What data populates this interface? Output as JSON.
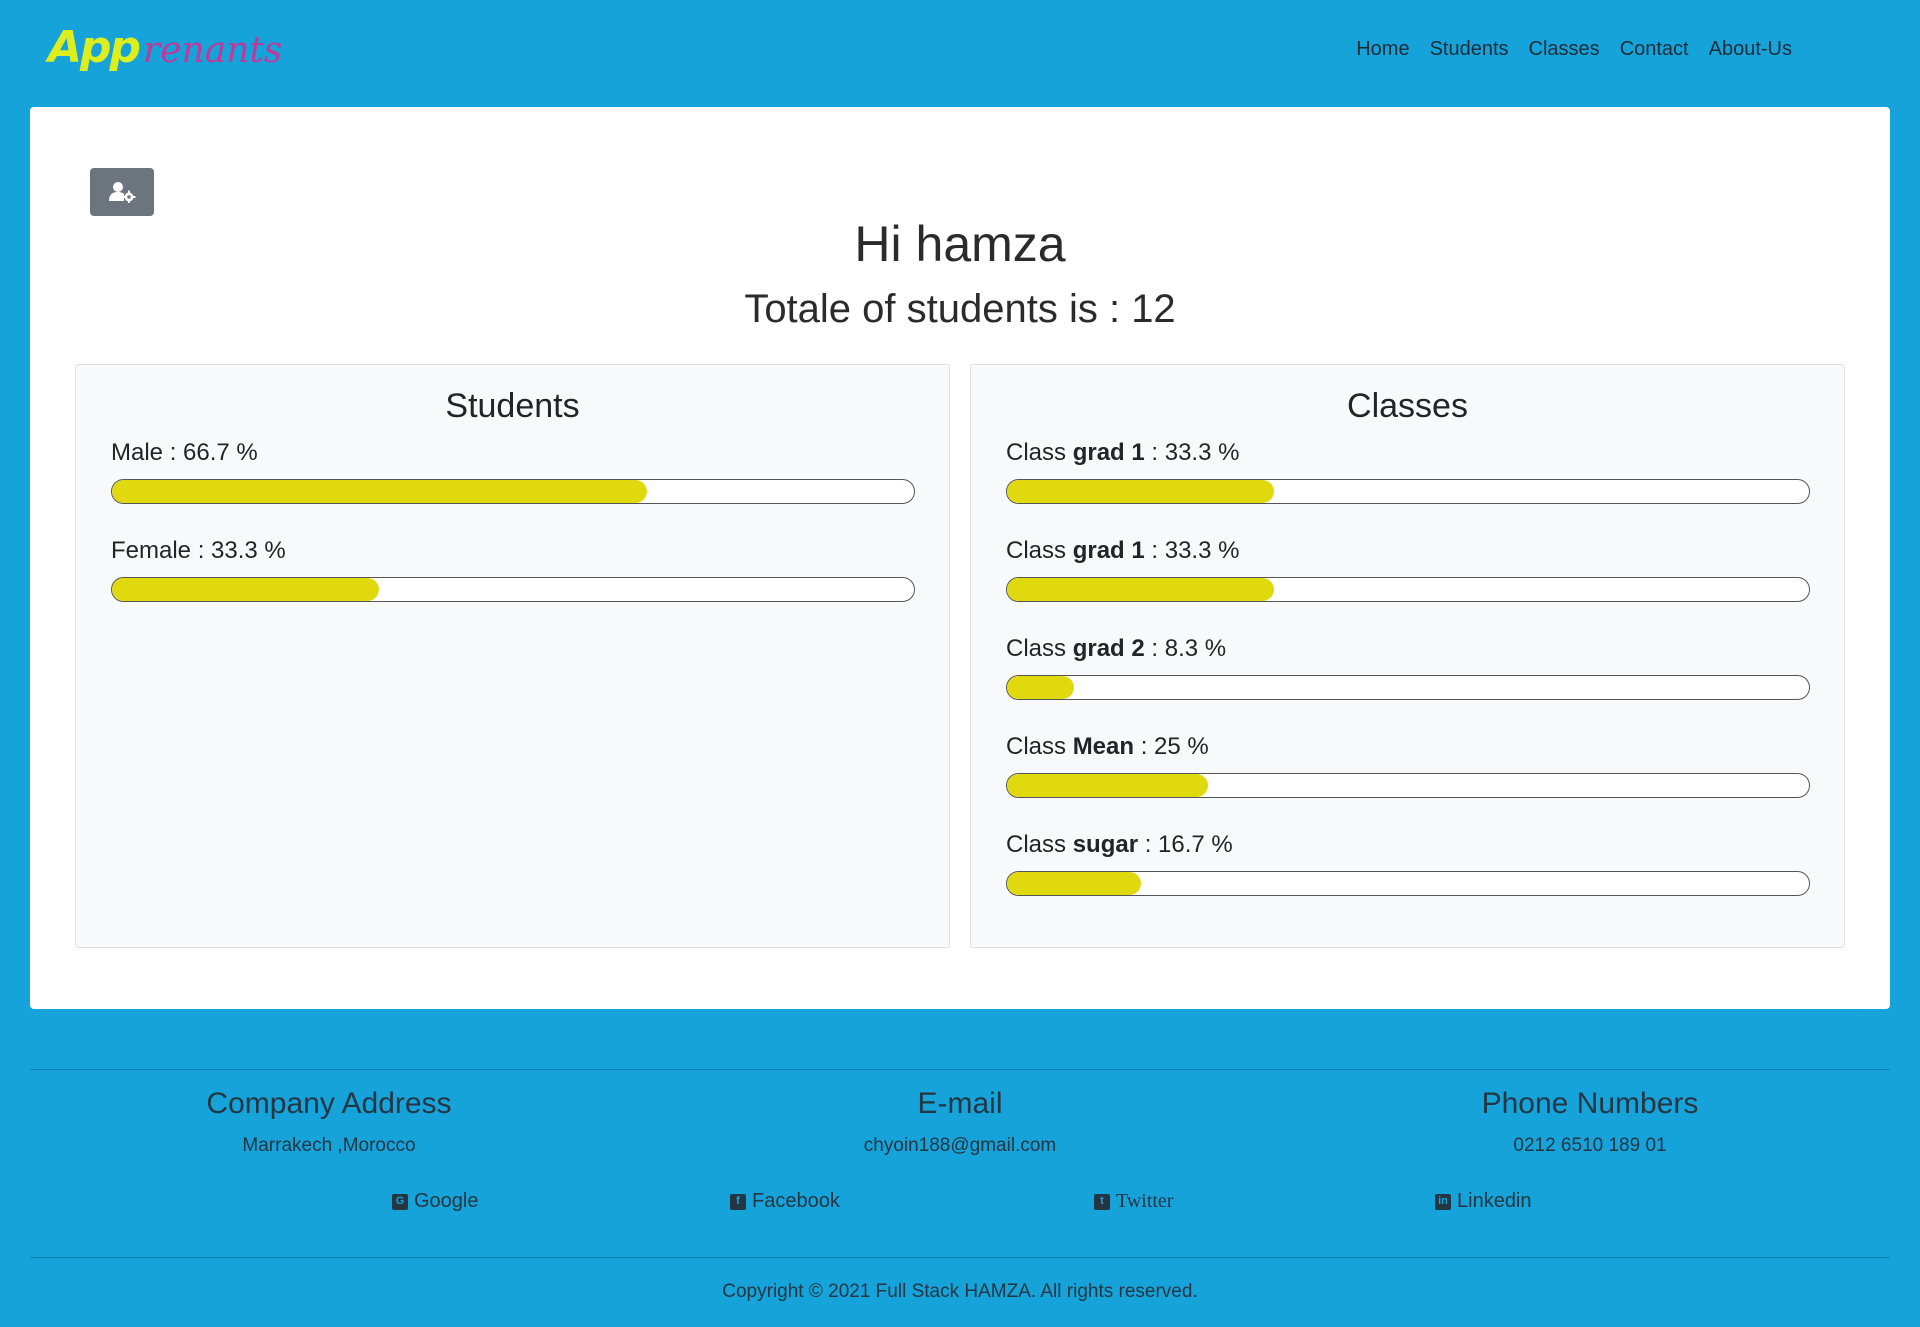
{
  "navbar": {
    "brand_app": "App",
    "brand_rest": "renants",
    "links": [
      "Home",
      "Students",
      "Classes",
      "Contact",
      "About-Us"
    ]
  },
  "main": {
    "greeting": "Hi hamza",
    "total": "Totale of students is : 12",
    "settings_icon": "user-gear-icon",
    "students_panel": {
      "title": "Students",
      "stats": [
        {
          "label": "Male : 66.7 %",
          "percent": 66.7
        },
        {
          "label": "Female : 33.3 %",
          "percent": 33.3
        }
      ]
    },
    "classes_panel": {
      "title": "Classes",
      "prefix": "Class",
      "stats": [
        {
          "name": "grad 1",
          "suffix": " : 33.3 %",
          "percent": 33.3
        },
        {
          "name": "grad 1",
          "suffix": " : 33.3 %",
          "percent": 33.3
        },
        {
          "name": "grad 2",
          "suffix": " : 8.3 %",
          "percent": 8.3
        },
        {
          "name": "Mean",
          "suffix": " : 25 %",
          "percent": 25
        },
        {
          "name": "sugar",
          "suffix": " : 16.7 %",
          "percent": 16.7
        }
      ]
    }
  },
  "footer": {
    "address": {
      "title": "Company Address",
      "value": "Marrakech ,Morocco"
    },
    "email": {
      "title": "E-mail",
      "value": "chyoin188@gmail.com"
    },
    "phone": {
      "title": "Phone Numbers",
      "value": "0212 6510 189 01"
    },
    "social": [
      {
        "label": "Google",
        "icon": "google-plus-icon"
      },
      {
        "label": "Facebook",
        "icon": "facebook-icon"
      },
      {
        "label": "Twitter",
        "icon": "twitter-icon"
      },
      {
        "label": "Linkedin",
        "icon": "linkedin-icon"
      }
    ],
    "copyright": "Copyright © 2021 Full Stack HAMZA. All rights reserved."
  },
  "colors": {
    "background": "#15a3da",
    "bar_fill": "#e0d90e",
    "brand_app": "#dcee1e",
    "brand_rest": "#c0389a"
  }
}
